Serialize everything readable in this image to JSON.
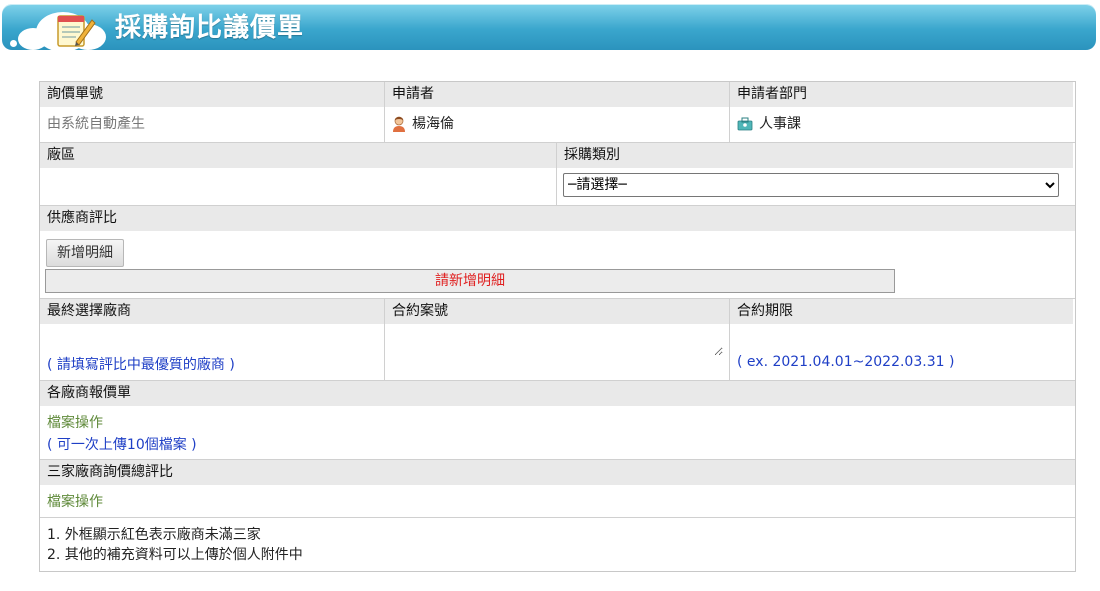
{
  "header": {
    "title": "採購詢比議價單",
    "icon": "notepad-pencil-icon"
  },
  "form": {
    "inquiry_no": {
      "label": "詢價單號",
      "value": "由系統自動產生"
    },
    "applicant": {
      "label": "申請者",
      "value": "楊海倫",
      "icon": "user-icon"
    },
    "department": {
      "label": "申請者部門",
      "value": "人事課",
      "icon": "department-icon"
    },
    "plant": {
      "label": "廠區",
      "value": ""
    },
    "purchase_type": {
      "label": "採購類別",
      "selected": "─請選擇─"
    },
    "supplier_compare": {
      "label": "供應商評比",
      "add_button": "新增明細",
      "notice": "請新增明細"
    },
    "final_vendor": {
      "label": "最終選擇廠商",
      "hint": "( 請填寫評比中最優質的廠商 )"
    },
    "contract_no": {
      "label": "合約案號",
      "value": ""
    },
    "contract_period": {
      "label": "合約期限",
      "hint": "( ex. 2021.04.01~2022.03.31 )"
    },
    "vendor_quotes": {
      "label": "各廠商報價單",
      "file_action": "檔案操作",
      "hint": "( 可一次上傳10個檔案 )"
    },
    "summary": {
      "label": "三家廠商詢價總評比",
      "file_action": "檔案操作"
    },
    "notes": [
      "1. 外框顯示紅色表示廠商未滿三家",
      "2. 其他的補充資料可以上傳於個人附件中"
    ]
  },
  "colors": {
    "banner": "#3aa6cd",
    "header_bg": "#e9e9e9",
    "link_blue": "#1f3fc6",
    "olive": "#5f8a3a",
    "red": "#e02020"
  }
}
